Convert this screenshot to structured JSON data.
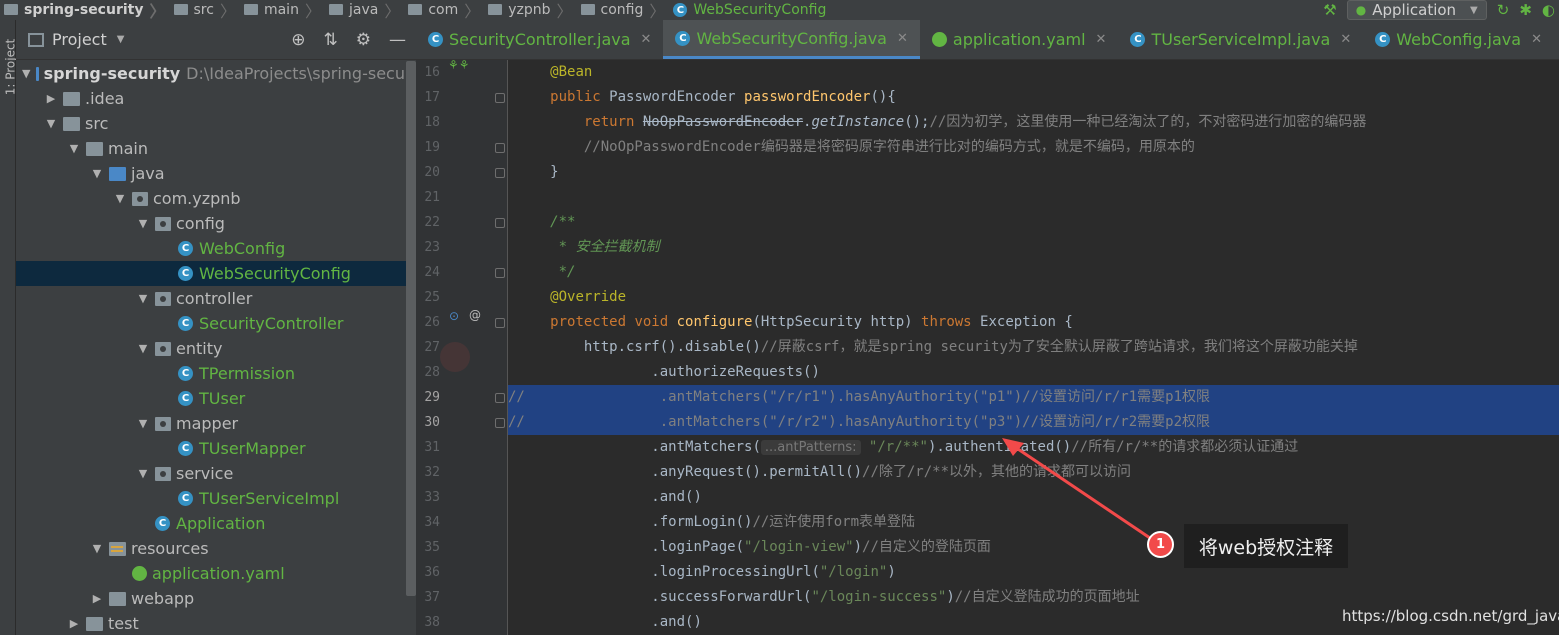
{
  "breadcrumbs": [
    {
      "label": "spring-security",
      "kind": "project"
    },
    {
      "label": "src",
      "kind": "folder"
    },
    {
      "label": "main",
      "kind": "folder"
    },
    {
      "label": "java",
      "kind": "folder"
    },
    {
      "label": "com",
      "kind": "folder"
    },
    {
      "label": "yzpnb",
      "kind": "folder"
    },
    {
      "label": "config",
      "kind": "folder"
    },
    {
      "label": "WebSecurityConfig",
      "kind": "class"
    }
  ],
  "run_config": {
    "label": "Application"
  },
  "toolstrip": {
    "label": "1: Project"
  },
  "project_panel": {
    "title": "Project",
    "tree": [
      {
        "label": "spring-security",
        "extra": "D:\\IdeaProjects\\spring-securi",
        "depth": 0,
        "arrow": "open",
        "icon": "module"
      },
      {
        "label": ".idea",
        "depth": 1,
        "arrow": "closed",
        "icon": "folder"
      },
      {
        "label": "src",
        "depth": 1,
        "arrow": "open",
        "icon": "folder"
      },
      {
        "label": "main",
        "depth": 2,
        "arrow": "open",
        "icon": "folder"
      },
      {
        "label": "java",
        "depth": 3,
        "arrow": "open",
        "icon": "source-folder"
      },
      {
        "label": "com.yzpnb",
        "depth": 4,
        "arrow": "open",
        "icon": "package"
      },
      {
        "label": "config",
        "depth": 5,
        "arrow": "open",
        "icon": "package"
      },
      {
        "label": "WebConfig",
        "depth": 6,
        "arrow": "none",
        "icon": "class"
      },
      {
        "label": "WebSecurityConfig",
        "depth": 6,
        "arrow": "none",
        "icon": "class",
        "selected": true
      },
      {
        "label": "controller",
        "depth": 5,
        "arrow": "open",
        "icon": "package"
      },
      {
        "label": "SecurityController",
        "depth": 6,
        "arrow": "none",
        "icon": "class"
      },
      {
        "label": "entity",
        "depth": 5,
        "arrow": "open",
        "icon": "package"
      },
      {
        "label": "TPermission",
        "depth": 6,
        "arrow": "none",
        "icon": "class"
      },
      {
        "label": "TUser",
        "depth": 6,
        "arrow": "none",
        "icon": "class"
      },
      {
        "label": "mapper",
        "depth": 5,
        "arrow": "open",
        "icon": "package"
      },
      {
        "label": "TUserMapper",
        "depth": 6,
        "arrow": "none",
        "icon": "class"
      },
      {
        "label": "service",
        "depth": 5,
        "arrow": "open",
        "icon": "package"
      },
      {
        "label": "TUserServiceImpl",
        "depth": 6,
        "arrow": "none",
        "icon": "class"
      },
      {
        "label": "Application",
        "depth": 5,
        "arrow": "none",
        "icon": "spring-class"
      },
      {
        "label": "resources",
        "depth": 3,
        "arrow": "open",
        "icon": "resources"
      },
      {
        "label": "application.yaml",
        "depth": 4,
        "arrow": "none",
        "icon": "yaml"
      },
      {
        "label": "webapp",
        "depth": 3,
        "arrow": "closed",
        "icon": "folder"
      },
      {
        "label": "test",
        "depth": 2,
        "arrow": "closed",
        "icon": "folder"
      }
    ]
  },
  "tabs": [
    {
      "label": "SecurityController.java",
      "icon": "class",
      "active": false
    },
    {
      "label": "WebSecurityConfig.java",
      "icon": "class",
      "active": true
    },
    {
      "label": "application.yaml",
      "icon": "yaml",
      "active": false
    },
    {
      "label": "TUserServiceImpl.java",
      "icon": "class",
      "active": false
    },
    {
      "label": "WebConfig.java",
      "icon": "class",
      "active": false
    }
  ],
  "code_lines": [
    {
      "n": "16",
      "indent": 4,
      "segs": [
        [
          "ann",
          "@Bean"
        ]
      ]
    },
    {
      "n": "17",
      "indent": 4,
      "segs": [
        [
          "kw",
          "public "
        ],
        [
          "",
          "PasswordEncoder "
        ],
        [
          "mth",
          "passwordEncoder"
        ],
        [
          "",
          "(){"
        ]
      ]
    },
    {
      "n": "18",
      "indent": 8,
      "segs": [
        [
          "kw",
          "return "
        ],
        [
          "strike",
          "NoOpPasswordEncoder"
        ],
        [
          "",
          "."
        ],
        [
          "ital",
          "getInstance"
        ],
        [
          "",
          "();"
        ],
        [
          "cmt",
          "//因为初学，这里使用一种已经淘汰了的，不对密码进行加密的编码器"
        ]
      ]
    },
    {
      "n": "19",
      "indent": 8,
      "segs": [
        [
          "cmt",
          "//NoOpPasswordEncoder编码器是将密码原字符串进行比对的编码方式，就是不编码，用原本的"
        ]
      ]
    },
    {
      "n": "20",
      "indent": 4,
      "segs": [
        [
          "",
          "}"
        ]
      ]
    },
    {
      "n": "21",
      "indent": 0,
      "segs": []
    },
    {
      "n": "22",
      "indent": 4,
      "segs": [
        [
          "dcm",
          "/**"
        ]
      ]
    },
    {
      "n": "23",
      "indent": 4,
      "segs": [
        [
          "dcm",
          " * 安全拦截机制"
        ]
      ]
    },
    {
      "n": "24",
      "indent": 4,
      "segs": [
        [
          "dcm",
          " */"
        ]
      ]
    },
    {
      "n": "25",
      "indent": 4,
      "segs": [
        [
          "ann",
          "@Override"
        ]
      ]
    },
    {
      "n": "26",
      "indent": 4,
      "segs": [
        [
          "kw",
          "protected void "
        ],
        [
          "mth",
          "configure"
        ],
        [
          "",
          "(HttpSecurity http) "
        ],
        [
          "kw",
          "throws "
        ],
        [
          "",
          "Exception {"
        ]
      ]
    },
    {
      "n": "27",
      "indent": 8,
      "segs": [
        [
          "",
          "http.csrf().disable()"
        ],
        [
          "cmt",
          "//屏蔽csrf，就是spring security为了安全默认屏蔽了跨站请求，我们将这个屏蔽功能关掉"
        ]
      ]
    },
    {
      "n": "28",
      "indent": 16,
      "segs": [
        [
          "",
          ".authorizeRequests()"
        ]
      ]
    },
    {
      "n": "29",
      "indent": 0,
      "hl": true,
      "segs": [
        [
          "cmt",
          "//"
        ],
        [
          "cmt",
          "                .antMatchers(\"/r/r1\").hasAnyAuthority(\"p1\")//设置访问/r/r1需要p1权限"
        ]
      ]
    },
    {
      "n": "30",
      "indent": 0,
      "hl": true,
      "segs": [
        [
          "cmt",
          "//"
        ],
        [
          "cmt",
          "                .antMatchers(\"/r/r2\").hasAnyAuthority(\"p3\")//设置访问/r/r2需要p2权限"
        ]
      ]
    },
    {
      "n": "31",
      "indent": 16,
      "segs": [
        [
          "",
          ".antMatchers("
        ],
        [
          "hint",
          "...antPatterns:"
        ],
        [
          "str",
          " \"/r/**\""
        ],
        [
          "",
          ").authenticated()"
        ],
        [
          "cmt",
          "//所有/r/**的请求都必须认证通过"
        ]
      ]
    },
    {
      "n": "32",
      "indent": 16,
      "segs": [
        [
          "",
          ".anyRequest().permitAll()"
        ],
        [
          "cmt",
          "//除了/r/**以外，其他的请求都可以访问"
        ]
      ]
    },
    {
      "n": "33",
      "indent": 16,
      "segs": [
        [
          "",
          ".and()"
        ]
      ]
    },
    {
      "n": "34",
      "indent": 16,
      "segs": [
        [
          "",
          ".formLogin()"
        ],
        [
          "cmt",
          "//运许使用form表单登陆"
        ]
      ]
    },
    {
      "n": "35",
      "indent": 16,
      "segs": [
        [
          "",
          ".loginPage("
        ],
        [
          "str",
          "\"/login-view\""
        ],
        [
          "",
          ")"
        ],
        [
          "cmt",
          "//自定义的登陆页面"
        ]
      ]
    },
    {
      "n": "36",
      "indent": 16,
      "segs": [
        [
          "",
          ".loginProcessingUrl("
        ],
        [
          "str",
          "\"/login\""
        ],
        [
          "",
          ")"
        ]
      ]
    },
    {
      "n": "37",
      "indent": 16,
      "segs": [
        [
          "",
          ".successForwardUrl("
        ],
        [
          "str",
          "\"/login-success\""
        ],
        [
          "",
          ")"
        ],
        [
          "cmt",
          "//自定义登陆成功的页面地址"
        ]
      ]
    },
    {
      "n": "38",
      "indent": 16,
      "segs": [
        [
          "",
          ".and()"
        ]
      ]
    }
  ],
  "annotation": {
    "badge": "1",
    "text": "将web授权注释"
  },
  "watermark": "https://blog.csdn.net/grd_java",
  "colors": {
    "accent": "#4a88c7",
    "selection": "#214283",
    "badge": "#f24a4a",
    "class_name": "#62b543"
  }
}
